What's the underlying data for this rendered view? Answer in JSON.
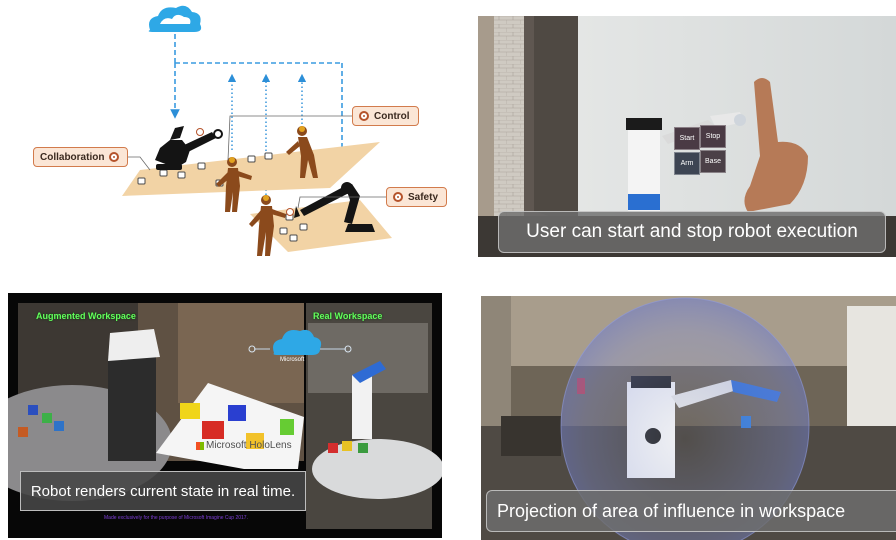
{
  "diagram": {
    "labels": {
      "collaboration": "Collaboration",
      "control": "Control",
      "safety": "Safety"
    },
    "colors": {
      "cloud": "#2ea8e6",
      "arrow": "#2c8fd8",
      "label_border": "#d27b4c",
      "label_fill": "#fbe6d6",
      "platform": "#f2d3a5",
      "figure": "#8b4a1c",
      "robot": "#111111"
    },
    "icons": [
      "cloud-icon",
      "human-figure-icon",
      "robot-arm-icon",
      "gear-icon"
    ]
  },
  "video_top_right": {
    "caption": "User can start and stop robot execution",
    "holo_buttons": [
      "Start",
      "Stop",
      "Arm",
      "Base"
    ]
  },
  "video_bottom_left": {
    "augmented_label": "Augmented Workspace",
    "real_label": "Real Workspace",
    "cloud_brand": "Microsoft",
    "holo_brand": "Microsoft HoloLens",
    "caption": "Robot renders current state in real time.",
    "credit": "Made exclusively for the purpose of Microsoft Imagine Cup 2017."
  },
  "video_bottom_right": {
    "caption": "Projection of area of influence in workspace"
  }
}
